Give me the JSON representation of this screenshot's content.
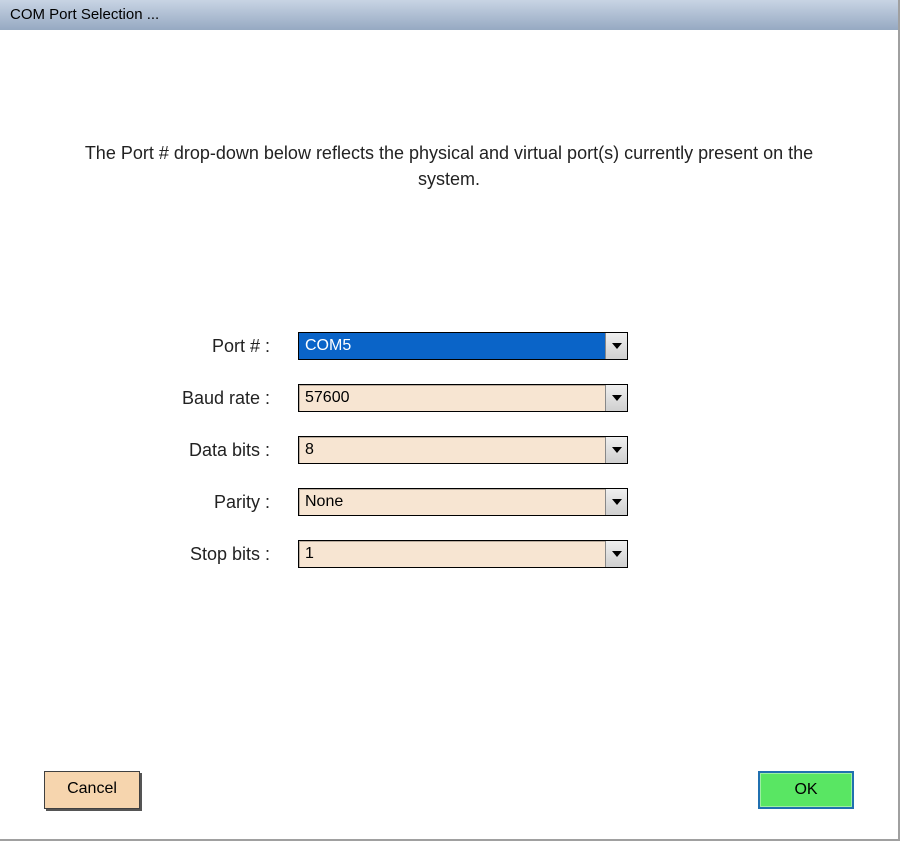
{
  "titlebar": {
    "title": "COM Port Selection ..."
  },
  "description": "The Port # drop-down below reflects the physical and virtual port(s) currently present on the system.",
  "form": {
    "port": {
      "label": "Port # :",
      "value": "COM5"
    },
    "baud": {
      "label": "Baud rate :",
      "value": "57600"
    },
    "databits": {
      "label": "Data bits :",
      "value": "8"
    },
    "parity": {
      "label": "Parity :",
      "value": "None"
    },
    "stopbits": {
      "label": "Stop bits :",
      "value": "1"
    }
  },
  "buttons": {
    "cancel": "Cancel",
    "ok": "OK"
  }
}
